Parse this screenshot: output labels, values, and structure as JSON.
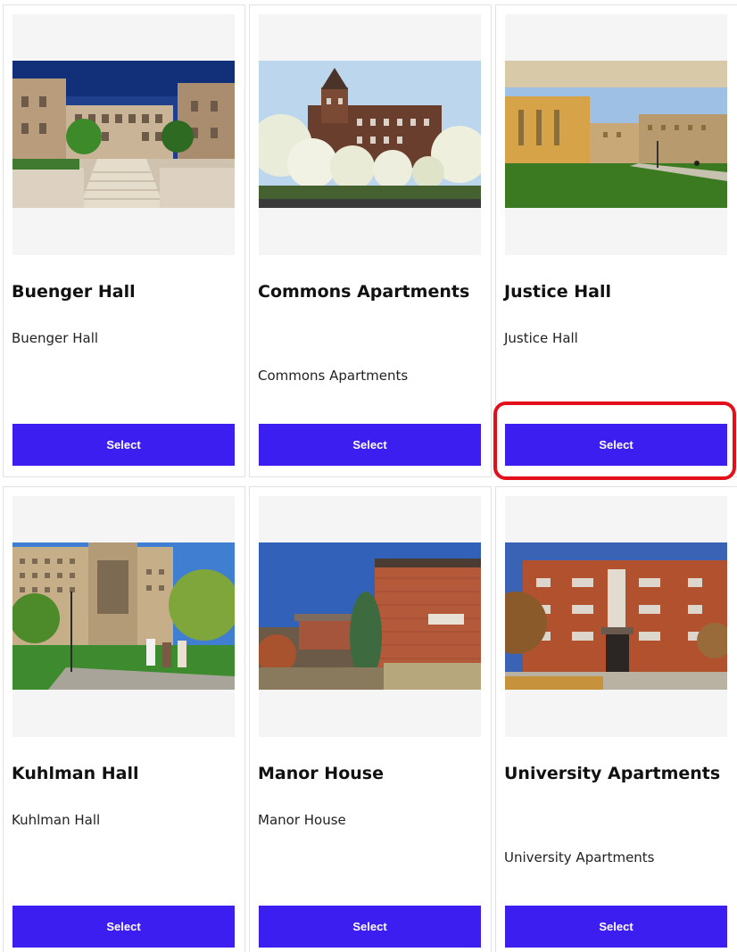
{
  "cards": [
    {
      "title": "Buenger Hall",
      "subtitle": "Buenger Hall",
      "button": "Select",
      "photo": "buenger-hall-photo"
    },
    {
      "title": "Commons Apartments",
      "subtitle": "Commons Apartments",
      "button": "Select",
      "photo": "commons-apartments-photo"
    },
    {
      "title": "Justice Hall",
      "subtitle": "Justice Hall",
      "button": "Select",
      "photo": "justice-hall-photo"
    },
    {
      "title": "Kuhlman Hall",
      "subtitle": "Kuhlman Hall",
      "button": "Select",
      "photo": "kuhlman-hall-photo"
    },
    {
      "title": "Manor House",
      "subtitle": "Manor House",
      "button": "Select",
      "photo": "manor-house-photo"
    },
    {
      "title": "University Apartments",
      "subtitle": "University Apartments",
      "button": "Select",
      "photo": "university-apartments-photo"
    }
  ],
  "colors": {
    "button": "#3d1ef0",
    "highlight": "#e3101b",
    "image_frame": "#f5f5f5"
  }
}
